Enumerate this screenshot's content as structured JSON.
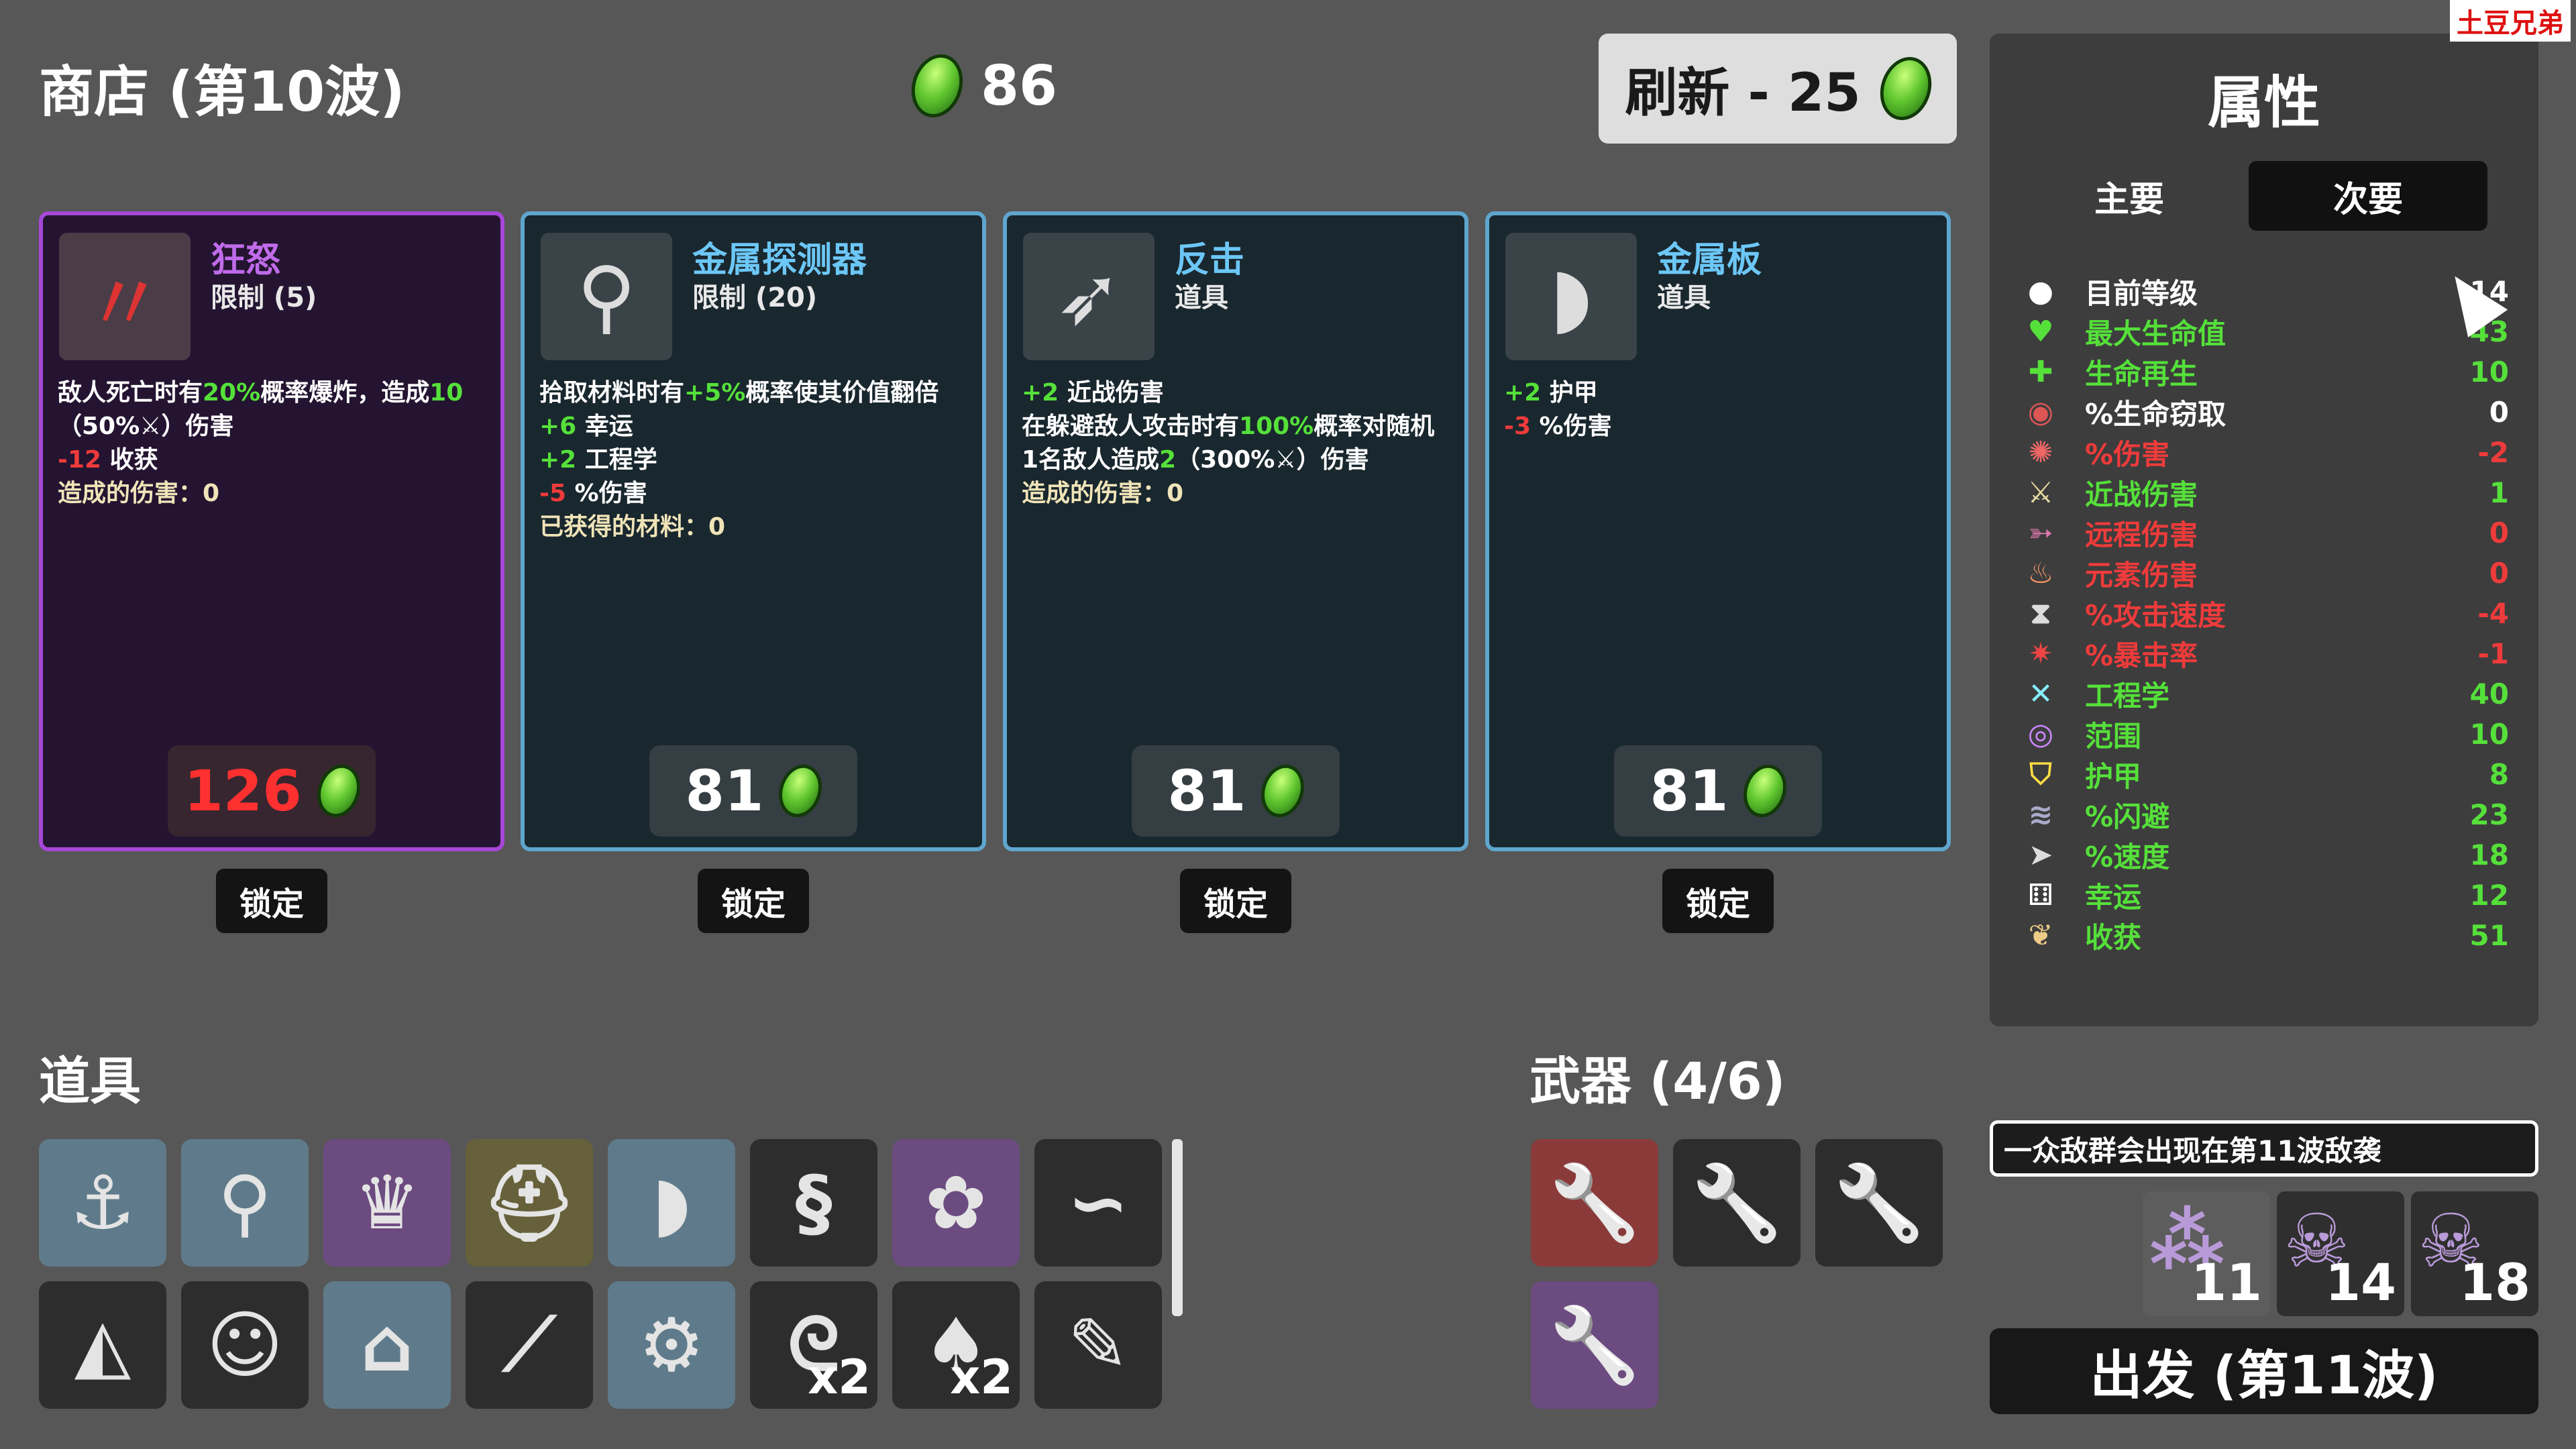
{
  "shop": {
    "title": "商店 (第10波)",
    "gold": "86",
    "refresh": "刷新 - 25"
  },
  "cards": [
    {
      "name": "狂怒",
      "sub": "限制 (5)",
      "price": "126",
      "tier": "legend",
      "icon": "rage-claw-icon",
      "desc": [
        [
          [
            "w",
            "敌人死亡时有"
          ],
          [
            "g",
            "20%"
          ],
          [
            "w",
            "概率爆炸，造成"
          ],
          [
            "g",
            "10"
          ]
        ],
        [
          [
            "w",
            "（50%"
          ],
          [
            "w",
            "⚔"
          ],
          [
            "w",
            "）伤害"
          ]
        ],
        [
          [
            "r",
            "-12"
          ],
          [
            "w",
            " 收获"
          ]
        ],
        [
          [
            "d",
            "造成的伤害：0"
          ]
        ]
      ]
    },
    {
      "name": "金属探测器",
      "sub": "限制 (20)",
      "price": "81",
      "tier": "rare",
      "icon": "metal-detector-icon",
      "desc": [
        [
          [
            "w",
            "拾取材料时有"
          ],
          [
            "g",
            "+5%"
          ],
          [
            "w",
            "概率使其价值翻倍"
          ]
        ],
        [
          [
            "g",
            "+6"
          ],
          [
            "w",
            " 幸运"
          ]
        ],
        [
          [
            "g",
            "+2"
          ],
          [
            "w",
            " 工程学"
          ]
        ],
        [
          [
            "r",
            "-5"
          ],
          [
            "w",
            " %伤害"
          ]
        ],
        [
          [
            "d",
            "已获得的材料：0"
          ]
        ]
      ]
    },
    {
      "name": "反击",
      "sub": "道具",
      "price": "81",
      "tier": "rare",
      "icon": "counter-attack-icon",
      "desc": [
        [
          [
            "g",
            "+2"
          ],
          [
            "w",
            " 近战伤害"
          ]
        ],
        [
          [
            "w",
            "在躲避敌人攻击时有"
          ],
          [
            "g",
            "100%"
          ],
          [
            "w",
            "概率对随机"
          ]
        ],
        [
          [
            "w",
            "1名敌人造成"
          ],
          [
            "g",
            "2"
          ],
          [
            "w",
            "（300%"
          ],
          [
            "w",
            "⚔"
          ],
          [
            "w",
            "）伤害"
          ]
        ],
        [
          [
            "d",
            "造成的伤害：0"
          ]
        ]
      ]
    },
    {
      "name": "金属板",
      "sub": "道具",
      "price": "81",
      "tier": "rare",
      "icon": "metal-plate-icon",
      "desc": [
        [
          [
            "g",
            "+2"
          ],
          [
            "w",
            " 护甲"
          ]
        ],
        [
          [
            "r",
            "-3"
          ],
          [
            "w",
            " %伤害"
          ]
        ]
      ]
    }
  ],
  "lock_label": "锁定",
  "items_title": "道具",
  "items": [
    {
      "icon": "hook-icon",
      "bg": "blue",
      "count": ""
    },
    {
      "icon": "metal-detector-icon",
      "bg": "blue",
      "count": ""
    },
    {
      "icon": "crown-icon",
      "bg": "purp",
      "count": ""
    },
    {
      "icon": "helmet-icon",
      "bg": "olive",
      "count": ""
    },
    {
      "icon": "metal-plate-icon",
      "bg": "blue",
      "count": ""
    },
    {
      "icon": "snake-icon",
      "bg": "dark",
      "count": ""
    },
    {
      "icon": "brain-icon",
      "bg": "purp",
      "count": ""
    },
    {
      "icon": "lizard-icon",
      "bg": "dark",
      "count": ""
    },
    {
      "icon": "cake-icon",
      "bg": "dark",
      "count": ""
    },
    {
      "icon": "monkey-icon",
      "bg": "dark",
      "count": ""
    },
    {
      "icon": "factory-icon",
      "bg": "blue",
      "count": ""
    },
    {
      "icon": "syringe-icon",
      "bg": "dark",
      "count": ""
    },
    {
      "icon": "gear-icon",
      "bg": "blue",
      "count": ""
    },
    {
      "icon": "scarf-icon",
      "bg": "dark",
      "count": "x2"
    },
    {
      "icon": "mushroom-icon",
      "bg": "dark",
      "count": "x2"
    },
    {
      "icon": "pencil-icon",
      "bg": "dark",
      "count": ""
    }
  ],
  "weapons_title": "武器 (4/6)",
  "weapons": [
    {
      "icon": "wrench-icon",
      "bg": "red"
    },
    {
      "icon": "wrench-icon",
      "bg": "dark"
    },
    {
      "icon": "wrench-icon",
      "bg": "dark"
    },
    {
      "icon": "wrench-icon",
      "bg": "purp"
    }
  ],
  "stats_panel": {
    "title": "属性",
    "tab_primary": "主要",
    "tab_secondary": "次要",
    "rows": [
      {
        "icon": "level-icon",
        "label": "目前等级",
        "value": "14",
        "color": "#ffffff"
      },
      {
        "icon": "heart-icon",
        "label": "最大生命值",
        "value": "43",
        "color": "#55e03a"
      },
      {
        "icon": "regen-icon",
        "label": "生命再生",
        "value": "10",
        "color": "#55e03a"
      },
      {
        "icon": "lifesteal-icon",
        "label": "%生命窃取",
        "value": "0",
        "color": "#ffffff"
      },
      {
        "icon": "damage-icon",
        "label": "%伤害",
        "value": "-2",
        "color": "#ef3b3b"
      },
      {
        "icon": "melee-icon",
        "label": "近战伤害",
        "value": "1",
        "color": "#55e03a"
      },
      {
        "icon": "ranged-icon",
        "label": "远程伤害",
        "value": "0",
        "color": "#ef3b3b"
      },
      {
        "icon": "elemental-icon",
        "label": "元素伤害",
        "value": "0",
        "color": "#ef3b3b"
      },
      {
        "icon": "attack-speed-icon",
        "label": "%攻击速度",
        "value": "-4",
        "color": "#ef3b3b"
      },
      {
        "icon": "crit-icon",
        "label": "%暴击率",
        "value": "-1",
        "color": "#ef3b3b"
      },
      {
        "icon": "engineering-icon",
        "label": "工程学",
        "value": "40",
        "color": "#55e03a"
      },
      {
        "icon": "range-icon",
        "label": "范围",
        "value": "10",
        "color": "#55e03a"
      },
      {
        "icon": "armor-icon",
        "label": "护甲",
        "value": "8",
        "color": "#55e03a"
      },
      {
        "icon": "dodge-icon",
        "label": "%闪避",
        "value": "23",
        "color": "#55e03a"
      },
      {
        "icon": "speed-icon",
        "label": "%速度",
        "value": "18",
        "color": "#55e03a"
      },
      {
        "icon": "luck-icon",
        "label": "幸运",
        "value": "12",
        "color": "#55e03a"
      },
      {
        "icon": "harvest-icon",
        "label": "收获",
        "value": "51",
        "color": "#55e03a"
      }
    ]
  },
  "wave_banner": "一众敌群会出现在第11波敌袭",
  "enemies": [
    {
      "icon": "bug-swarm-icon",
      "count": "11",
      "bg": "#5d5d5d"
    },
    {
      "icon": "horned-skull-icon",
      "count": "14",
      "bg": "#2f2f2f"
    },
    {
      "icon": "horned-skull-icon",
      "count": "18",
      "bg": "#2f2f2f"
    }
  ],
  "go_button": "出发 (第11波)",
  "watermark": "土豆兄弟"
}
